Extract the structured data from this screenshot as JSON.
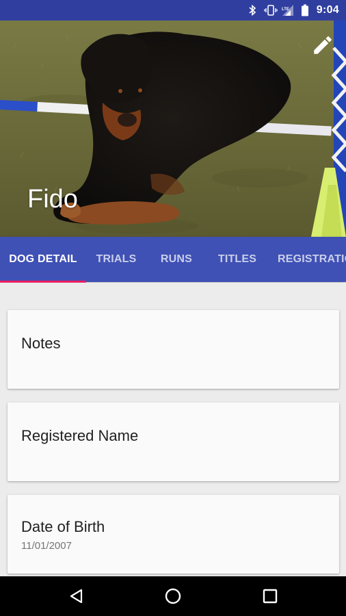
{
  "status_bar": {
    "time": "9:04",
    "icons": [
      "bluetooth-icon",
      "vibrate-icon",
      "lte-signal-icon",
      "battery-icon"
    ],
    "network_label": "LTE"
  },
  "header": {
    "dog_name": "Fido",
    "edit_icon": "pencil-icon"
  },
  "tabs": {
    "items": [
      {
        "label": "DOG DETAIL",
        "active": true
      },
      {
        "label": "TRIALS",
        "active": false
      },
      {
        "label": "RUNS",
        "active": false
      },
      {
        "label": "TITLES",
        "active": false
      },
      {
        "label": "REGISTRATIO",
        "active": false
      }
    ],
    "indicator_color": "#e91e63"
  },
  "cards": [
    {
      "title": "Notes",
      "value": ""
    },
    {
      "title": "Registered Name",
      "value": ""
    },
    {
      "title": "Date of Birth",
      "value": "11/01/2007"
    }
  ],
  "nav_bar": {
    "buttons": [
      "back-icon",
      "home-icon",
      "recents-icon"
    ]
  },
  "colors": {
    "primary": "#3f51b5",
    "primary_dark": "#303f9f",
    "accent": "#e91e63",
    "background": "#ececec",
    "card": "#fafafa"
  }
}
